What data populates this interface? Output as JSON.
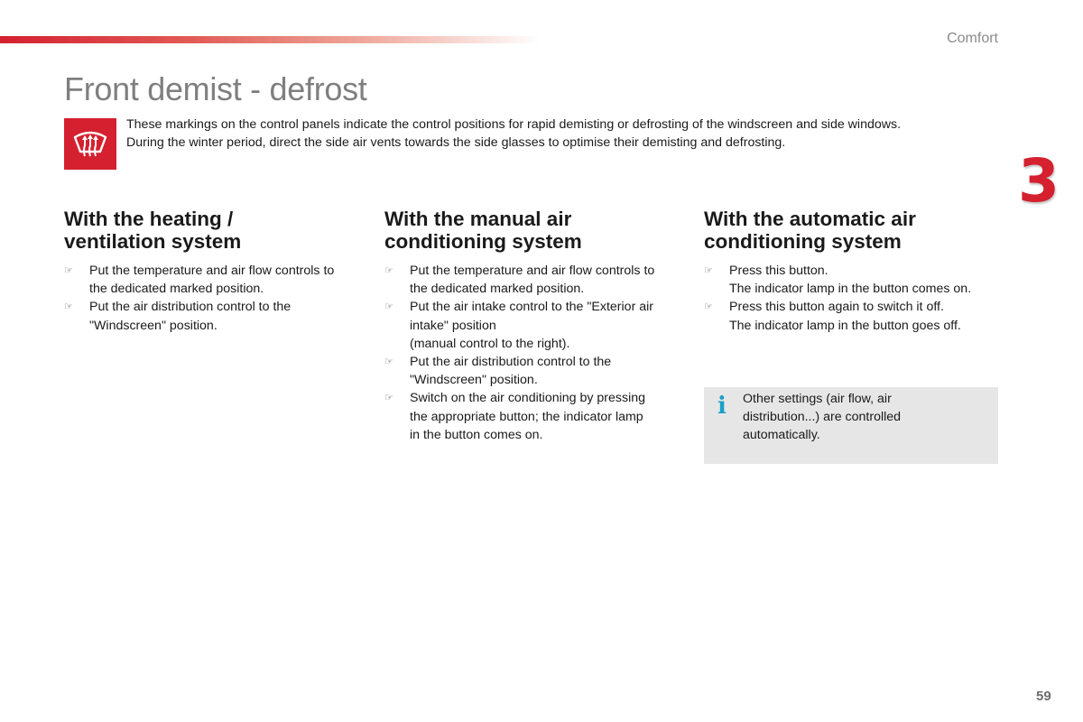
{
  "header": {
    "section": "Comfort",
    "chapter_number": "3"
  },
  "page_title": "Front demist - defrost",
  "intro": {
    "icon": "windscreen-defrost-icon",
    "lines": [
      "These markings on the control panels indicate the control positions for rapid demisting or defrosting of the windscreen and side windows.",
      "During the winter period, direct the side air vents towards the side glasses to optimise their demisting and defrosting."
    ]
  },
  "columns": [
    {
      "title_lines": [
        "With the heating /",
        "ventilation system"
      ],
      "items": [
        {
          "lines": [
            "Put the temperature and air flow controls to",
            "the dedicated marked position."
          ]
        },
        {
          "lines": [
            "Put the air distribution control to the",
            "\"Windscreen\" position."
          ]
        }
      ]
    },
    {
      "title_lines": [
        "With the manual air",
        "conditioning system"
      ],
      "items": [
        {
          "lines": [
            "Put the temperature and air flow controls to",
            "the dedicated marked position."
          ]
        },
        {
          "lines": [
            "Put the air intake control to the \"Exterior air",
            "intake\" position",
            "(manual control to the right)."
          ]
        },
        {
          "lines": [
            "Put the air distribution control to the",
            "\"Windscreen\" position."
          ]
        },
        {
          "lines": [
            "Switch on the air conditioning by pressing",
            "the appropriate button; the indicator lamp",
            "in the button comes on."
          ]
        }
      ]
    },
    {
      "title_lines": [
        "With the automatic air",
        "conditioning system"
      ],
      "items": [
        {
          "lines": [
            "Press this button.",
            "The indicator lamp in the button comes on."
          ]
        },
        {
          "lines": [
            "Press this button again to switch it off.",
            "The indicator lamp in the button goes off."
          ]
        }
      ]
    }
  ],
  "info_note": {
    "icon": "info-icon",
    "icon_glyph": "i",
    "lines": [
      "Other settings (air flow, air",
      "distribution...) are controlled",
      "automatically."
    ]
  },
  "bullet_glyph": "☞",
  "page_number": "59",
  "colors": {
    "accent_red": "#d4202f",
    "info_blue": "#1a9fc8",
    "info_bg": "#e6e6e6",
    "title_gray": "#7f7f7f"
  }
}
